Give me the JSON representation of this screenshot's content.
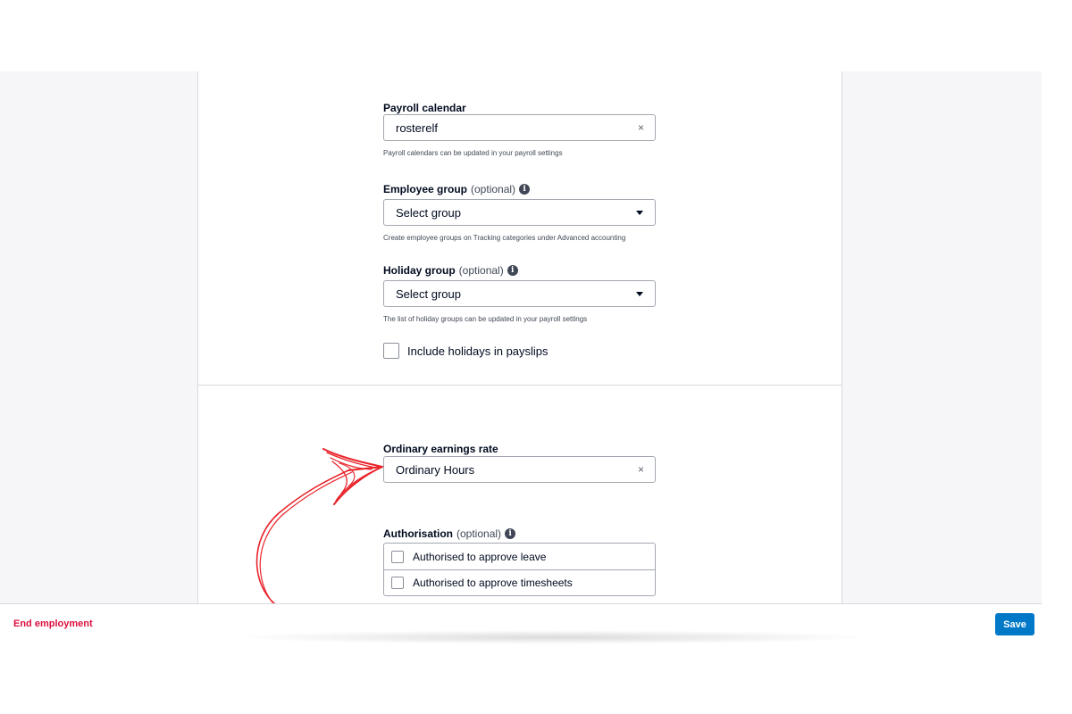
{
  "payroll_calendar": {
    "label": "Payroll calendar",
    "value": "rosterelf",
    "help": "Payroll calendars can be updated in your payroll settings"
  },
  "employee_group": {
    "label": "Employee group",
    "optional": "(optional)",
    "value": "Select group",
    "help": "Create employee groups on Tracking categories under Advanced accounting"
  },
  "holiday_group": {
    "label": "Holiday group",
    "optional": "(optional)",
    "value": "Select group",
    "help": "The list of holiday groups can be updated in your payroll settings"
  },
  "include_holidays": {
    "label": "Include holidays in payslips",
    "checked": false
  },
  "ordinary_earnings": {
    "label": "Ordinary earnings rate",
    "value": "Ordinary Hours"
  },
  "authorisation": {
    "label": "Authorisation",
    "optional": "(optional)",
    "options": [
      {
        "label": "Authorised to approve leave",
        "checked": false
      },
      {
        "label": "Authorised to approve timesheets",
        "checked": false
      }
    ]
  },
  "icons": {
    "clear": "×",
    "info": "i"
  },
  "footer": {
    "end_employment": "End employment",
    "save": "Save"
  },
  "colors": {
    "primary": "#0078c8",
    "danger": "#de0e40",
    "annotation": "#e8242b"
  }
}
